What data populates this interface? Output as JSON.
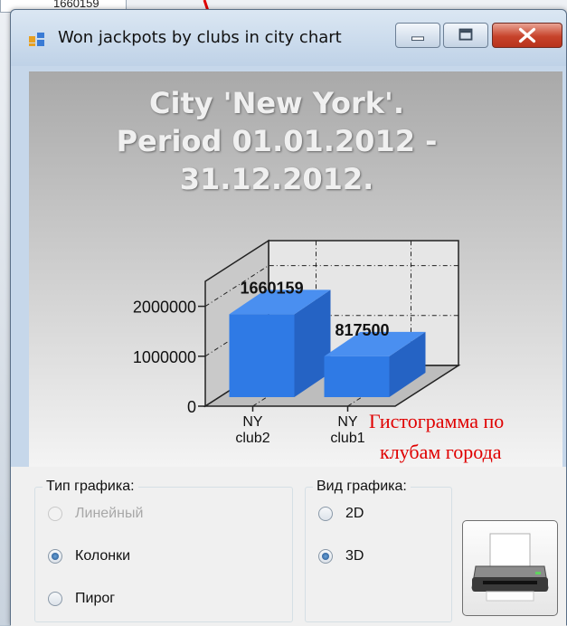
{
  "window": {
    "title": "Won jackpots by clubs in city chart"
  },
  "background_cell": "1660159",
  "chart_data": {
    "type": "bar",
    "title_lines": [
      "City 'New York'.",
      "Period 01.01.2012 -",
      "31.12.2012."
    ],
    "categories": [
      [
        "NY",
        "club2"
      ],
      [
        "NY",
        "club1"
      ]
    ],
    "values": [
      1660159,
      817500
    ],
    "data_labels": [
      "1660159",
      "817500"
    ],
    "ylim": [
      0,
      2500000
    ],
    "y_ticks": [
      "0",
      "1000000",
      "2000000"
    ],
    "y_tick_values": [
      0,
      1000000,
      2000000
    ],
    "bar_color": "#2f7ae5",
    "style": "3D",
    "grid": true
  },
  "controls": {
    "chart_type_group": {
      "legend": "Тип графика:",
      "options": [
        {
          "label": "Линейный",
          "checked": false,
          "disabled": true
        },
        {
          "label": "Колонки",
          "checked": true,
          "disabled": false
        },
        {
          "label": "Пирог",
          "checked": false,
          "disabled": false
        }
      ]
    },
    "view_group": {
      "legend": "Вид графика:",
      "options": [
        {
          "label": "2D",
          "checked": false
        },
        {
          "label": "3D",
          "checked": true
        }
      ]
    },
    "print_button": {
      "icon": "printer-icon"
    }
  },
  "annotation": {
    "line1": "Гистограмма по",
    "line2": "клубам города",
    "color": "#e00000"
  }
}
